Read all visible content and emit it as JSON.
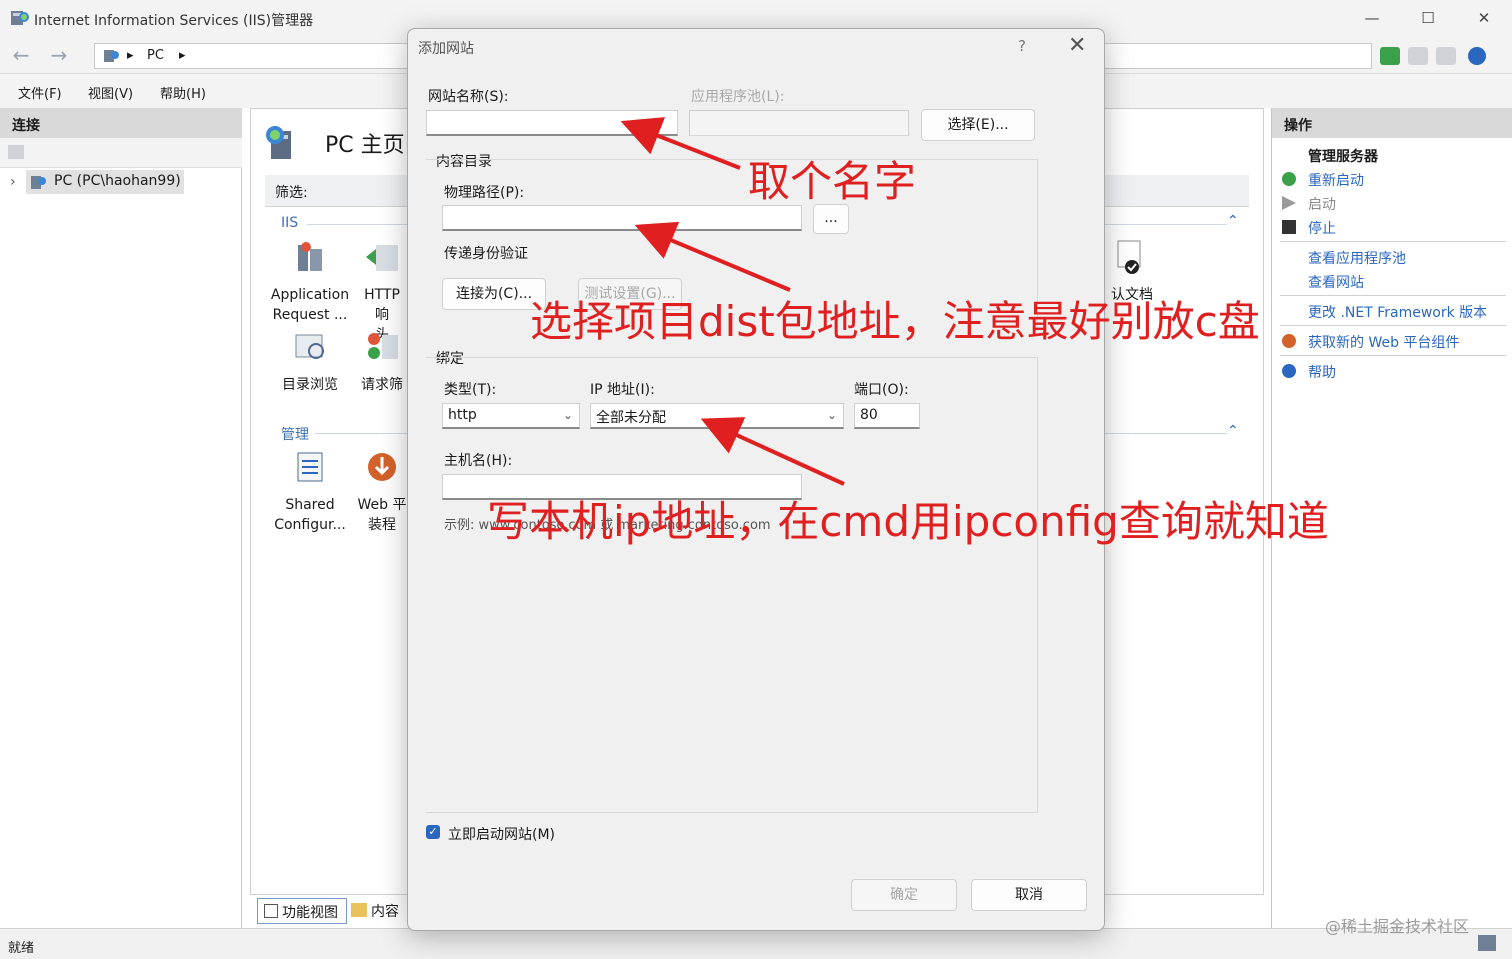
{
  "window": {
    "title": "Internet Information Services (IIS)管理器",
    "minimize_glyph": "—",
    "maximize_glyph": "☐",
    "close_glyph": "✕"
  },
  "nav": {
    "back_glyph": "←",
    "forward_glyph": "→",
    "breadcrumb": [
      "PC"
    ],
    "sep_glyph": "▸"
  },
  "menu": {
    "items": [
      "文件(F)",
      "视图(V)",
      "帮助(H)"
    ]
  },
  "connections": {
    "header": "连接",
    "tree_root": "PC (PC\\haohan99)",
    "expand_glyph": "›"
  },
  "center": {
    "title": "PC 主页",
    "filter_label": "筛选:",
    "groups": [
      {
        "label": "IIS"
      },
      {
        "label": "管理"
      }
    ],
    "features": [
      {
        "label1": "Application",
        "label2": "Request ..."
      },
      {
        "label1": "HTTP 响",
        "label2": "头"
      },
      {
        "label1": "目录浏览",
        "label2": ""
      },
      {
        "label1": "请求筛",
        "label2": ""
      },
      {
        "label1": "Shared",
        "label2": "Configur..."
      },
      {
        "label1": "Web 平",
        "label2": "装程"
      },
      {
        "label1": "认文档",
        "label2": ""
      }
    ],
    "collapse_glyph": "⌃",
    "bottom_tabs": [
      "功能视图",
      "内容视"
    ]
  },
  "actions": {
    "header": "操作",
    "section": "管理服务器",
    "items": [
      {
        "label": "重新启动",
        "disabled": false
      },
      {
        "label": "启动",
        "disabled": true
      },
      {
        "label": "停止",
        "disabled": false
      },
      {
        "label": "查看应用程序池",
        "disabled": false
      },
      {
        "label": "查看网站",
        "disabled": false
      },
      {
        "label": "更改 .NET Framework 版本",
        "disabled": false
      },
      {
        "label": "获取新的 Web 平台组件",
        "disabled": false
      },
      {
        "label": "帮助",
        "disabled": false
      }
    ]
  },
  "status": {
    "text": "就绪"
  },
  "dialog": {
    "title": "添加网站",
    "help_glyph": "?",
    "close_glyph": "✕",
    "site_name_label": "网站名称(S):",
    "site_name_value": "",
    "app_pool_label": "应用程序池(L):",
    "app_pool_value": "",
    "select_button": "选择(E)...",
    "content_dir_label": "内容目录",
    "physical_path_label": "物理路径(P):",
    "physical_path_value": "",
    "browse_button": "...",
    "pass_auth_label": "传递身份验证",
    "connect_as_button": "连接为(C)...",
    "test_settings_button": "测试设置(G)...",
    "binding_label": "绑定",
    "type_label": "类型(T):",
    "type_value": "http",
    "ip_label": "IP 地址(I):",
    "ip_value": "全部未分配",
    "port_label": "端口(O):",
    "port_value": "80",
    "host_label": "主机名(H):",
    "host_value": "",
    "example": "示例: www.contoso.com 或 marketing.contoso.com",
    "start_now_label": "立即启动网站(M)",
    "start_now_checked": true,
    "check_glyph": "✓",
    "chev_glyph": "⌄",
    "ok_button": "确定",
    "cancel_button": "取消"
  },
  "annotations": {
    "name_hint": "取个名字",
    "path_hint": "选择项目dist包地址，注意最好别放c盘",
    "ip_hint": "写本机ip地址，在cmd用ipconfig查询就知道",
    "color": "#e02020"
  },
  "watermark": "@稀土掘金技术社区"
}
